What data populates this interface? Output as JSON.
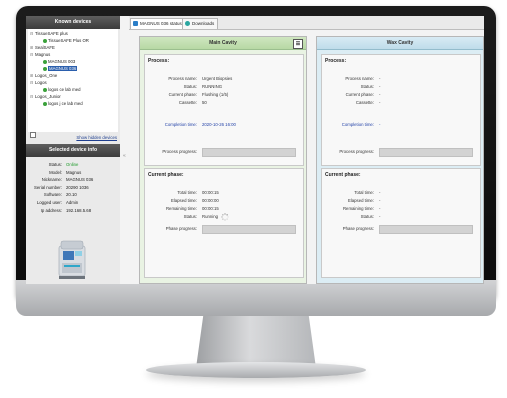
{
  "tabs": [
    {
      "label": "MAGNUS 036 status",
      "icon": "monitor-icon"
    },
    {
      "label": "Downloads",
      "icon": "download-icon"
    }
  ],
  "known_devices": {
    "title": "Known devices",
    "items": [
      {
        "label": "TissueSAFE plus",
        "level": 0,
        "toggle": "⊟"
      },
      {
        "label": "TissueSAFE Plus OR",
        "level": 1,
        "online": true
      },
      {
        "label": "SealSAFE",
        "level": 0,
        "toggle": "⊞"
      },
      {
        "label": "Magnus",
        "level": 0,
        "toggle": "⊟"
      },
      {
        "label": "MAGNUS 003",
        "level": 1,
        "online": true
      },
      {
        "label": "MAGNUS 036",
        "level": 1,
        "online": true,
        "selected": true
      },
      {
        "label": "Logos_One",
        "level": 0,
        "toggle": "⊞"
      },
      {
        "label": "Logos",
        "level": 0,
        "toggle": "⊟"
      },
      {
        "label": "logos ce lab med",
        "level": 1,
        "online": true
      },
      {
        "label": "Logos_Junior",
        "level": 0,
        "toggle": "⊟"
      },
      {
        "label": "logos j ce lab med",
        "level": 1,
        "online": true
      }
    ],
    "show_hidden_label": "Show hidden devices"
  },
  "selected_device": {
    "title": "Selected device info",
    "rows": [
      {
        "key": "Status:",
        "value": "Online",
        "status": true
      },
      {
        "key": "Model:",
        "value": "Magnus"
      },
      {
        "key": "Nickname:",
        "value": "MAGNUS 036"
      },
      {
        "key": "Serial number:",
        "value": "20290 1036"
      },
      {
        "key": "Software:",
        "value": "20.10"
      },
      {
        "key": "Logged user:",
        "value": "Admin"
      },
      {
        "key": "Ip address:",
        "value": "192.168.5.68"
      }
    ]
  },
  "main_cavity": {
    "title": "Main Cavity",
    "process_title": "Process:",
    "process_rows": [
      {
        "key": "Process name:",
        "value": "Urgent Biopsies"
      },
      {
        "key": "Status:",
        "value": "RUNNING"
      },
      {
        "key": "Current phase:",
        "value": "Flushing (1/5)"
      },
      {
        "key": "Cassette:",
        "value": "50"
      }
    ],
    "completion_key": "Completion time:",
    "completion_value": "2020-10-26 16:00",
    "process_progress_key": "Process progress:",
    "process_progress": 0,
    "phase_title": "Current phase:",
    "phase_rows": [
      {
        "key": "Total time:",
        "value": "00:00:15"
      },
      {
        "key": "Elapsed time:",
        "value": "00:00:00"
      },
      {
        "key": "Remaining time:",
        "value": "00:00:15"
      },
      {
        "key": "Status:",
        "value": "Running"
      }
    ],
    "phase_progress_key": "Phase progress:",
    "phase_progress": 0
  },
  "wax_cavity": {
    "title": "Wax Cavity",
    "process_title": "Process:",
    "process_rows": [
      {
        "key": "Process name:",
        "value": "-"
      },
      {
        "key": "Status:",
        "value": "-"
      },
      {
        "key": "Current phase:",
        "value": "-"
      },
      {
        "key": "Cassette:",
        "value": "-"
      }
    ],
    "completion_key": "Completion time:",
    "completion_value": "-",
    "process_progress_key": "Process progress:",
    "process_progress": 0,
    "phase_title": "Current phase:",
    "phase_rows": [
      {
        "key": "Total time:",
        "value": "-"
      },
      {
        "key": "Elapsed time:",
        "value": "-"
      },
      {
        "key": "Remaining time:",
        "value": "-"
      },
      {
        "key": "Status:",
        "value": "-"
      }
    ],
    "phase_progress_key": "Phase progress:",
    "phase_progress": 0
  },
  "colors": {
    "online": "#1e9a2a",
    "selected": "#2b5fad",
    "main_header": "#b7d8a4",
    "wax_header": "#bfdcea",
    "completion_text": "#2443a8"
  }
}
